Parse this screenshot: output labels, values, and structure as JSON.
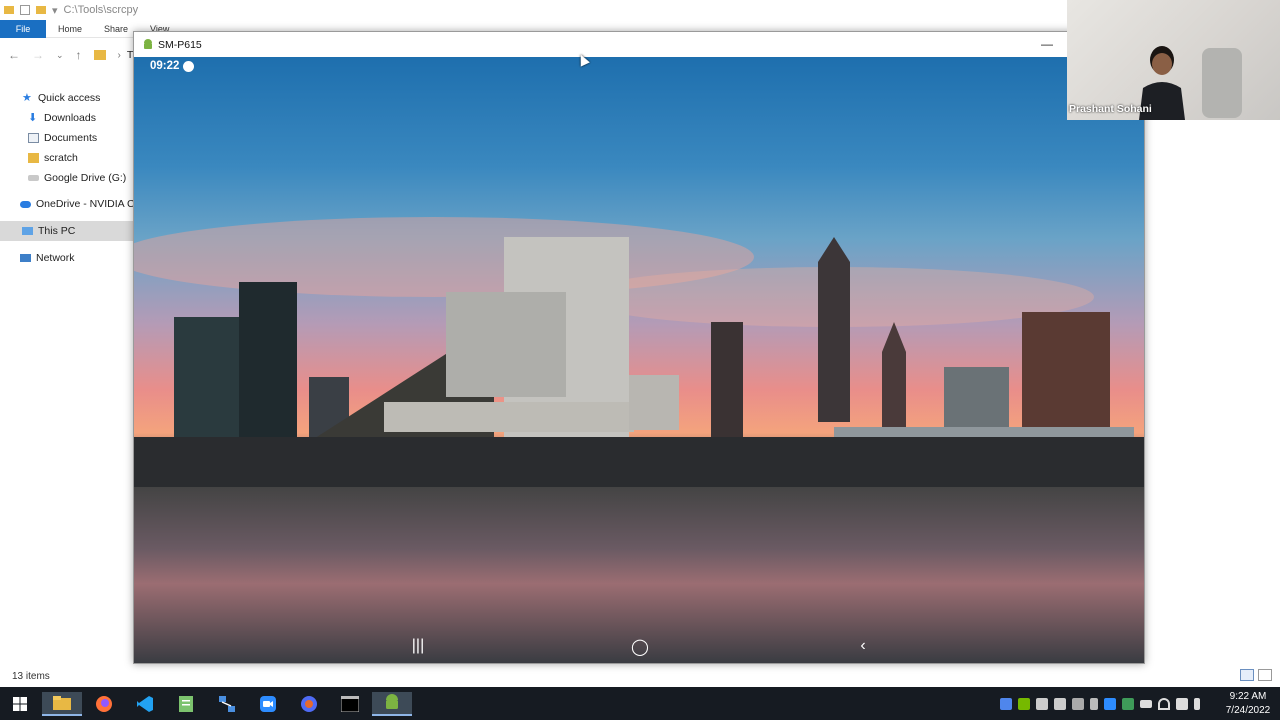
{
  "explorer": {
    "path": "C:\\Tools\\scrcpy",
    "ribbon_tabs": [
      "File",
      "Home",
      "Share",
      "View"
    ],
    "breadcrumb_text": "Thi",
    "nav": [
      {
        "label": "Quick access"
      },
      {
        "label": "Downloads"
      },
      {
        "label": "Documents"
      },
      {
        "label": "scratch"
      },
      {
        "label": "Google Drive (G:)"
      },
      {
        "label": "OneDrive - NVIDIA Co"
      },
      {
        "label": "This PC"
      },
      {
        "label": "Network"
      }
    ],
    "status": "13 items"
  },
  "scrcpy": {
    "title": "SM-P615",
    "minimize_glyph": "—",
    "status_time": "09:22",
    "nav": {
      "recents": "|||",
      "home": "◯",
      "back": "‹"
    }
  },
  "video": {
    "name": "Prashant Sohani"
  },
  "taskbar": {
    "time": "9:22 AM",
    "date": "7/24/2022",
    "apps": [
      "windows-start-icon",
      "file-explorer-icon",
      "firefox-icon",
      "vscode-icon",
      "notepad-icon",
      "network-app-icon",
      "zoom-icon",
      "browser-icon",
      "terminal-icon",
      "android-icon"
    ]
  },
  "colors": {
    "ribbon_file": "#1a6fc2",
    "taskbar": "#161b22",
    "selected_nav": "#d9d9d9"
  }
}
